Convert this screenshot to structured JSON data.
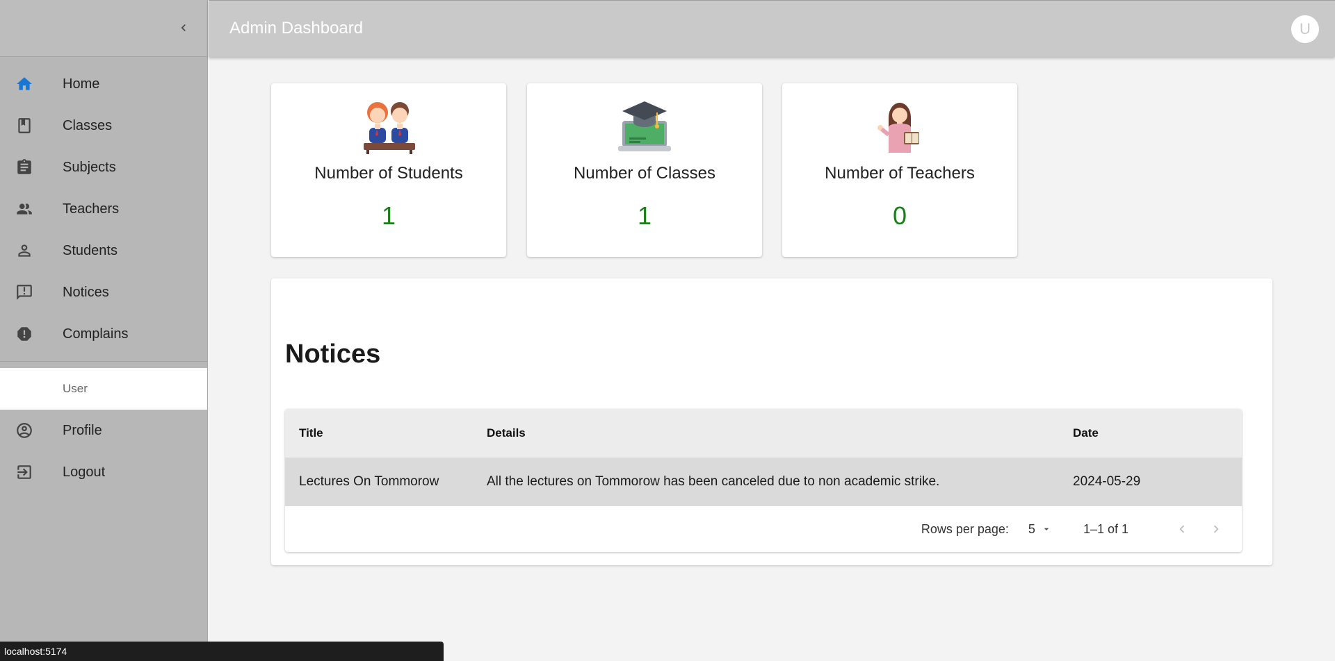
{
  "header": {
    "title": "Admin Dashboard",
    "avatar_letter": "U"
  },
  "sidebar": {
    "items": [
      {
        "label": "Home",
        "icon": "home-icon"
      },
      {
        "label": "Classes",
        "icon": "class-icon"
      },
      {
        "label": "Subjects",
        "icon": "assignment-icon"
      },
      {
        "label": "Teachers",
        "icon": "teachers-icon"
      },
      {
        "label": "Students",
        "icon": "person-icon"
      },
      {
        "label": "Notices",
        "icon": "announcement-icon"
      },
      {
        "label": "Complains",
        "icon": "report-icon"
      }
    ],
    "section_label": "User",
    "user_items": [
      {
        "label": "Profile",
        "icon": "account-circle-icon"
      },
      {
        "label": "Logout",
        "icon": "logout-icon"
      }
    ]
  },
  "stats": [
    {
      "title": "Number of Students",
      "value": "1",
      "icon": "students-illustration"
    },
    {
      "title": "Number of Classes",
      "value": "1",
      "icon": "graduation-laptop-illustration"
    },
    {
      "title": "Number of Teachers",
      "value": "0",
      "icon": "teacher-illustration"
    }
  ],
  "notices": {
    "title": "Notices",
    "columns": [
      "Title",
      "Details",
      "Date"
    ],
    "rows": [
      {
        "title": "Lectures On Tommorow",
        "details": "All the lectures on Tommorow has been canceled due to non academic strike.",
        "date": "2024-05-29"
      }
    ],
    "pagination": {
      "rows_per_page_label": "Rows per page:",
      "rows_per_page": "5",
      "range": "1–1 of 1"
    }
  },
  "statusbar": {
    "url": "localhost:5174"
  },
  "colors": {
    "accent": "#1976d2",
    "stat_value": "#1a7f1a",
    "sidebar_bg": "#b7b7b7",
    "header_bg": "#c9c9c9"
  }
}
